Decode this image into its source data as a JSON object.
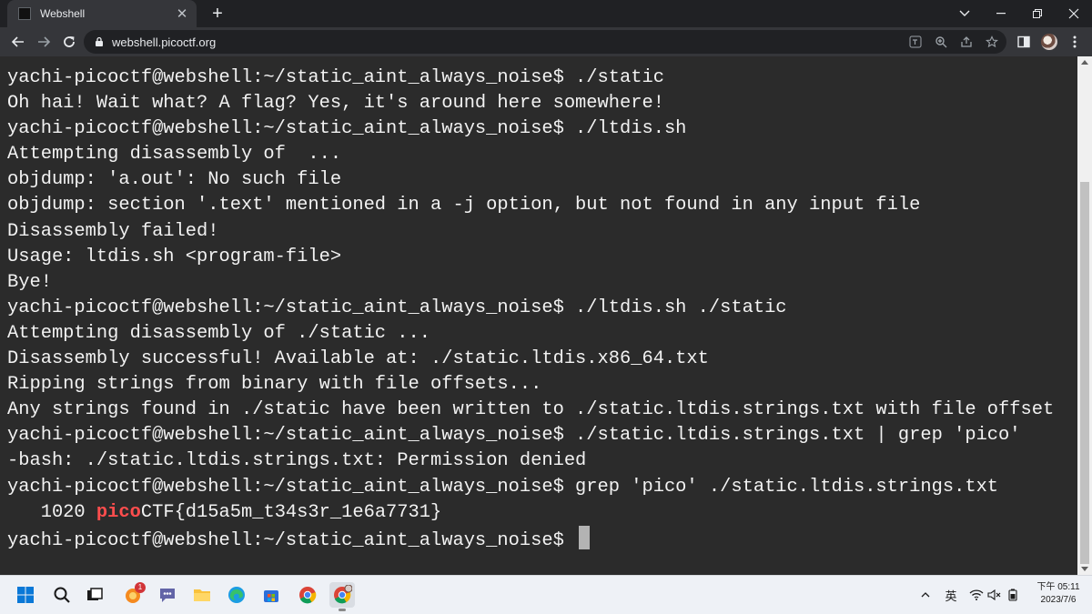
{
  "browser": {
    "tab_title": "Webshell",
    "url": "webshell.picoctf.org",
    "new_tab_symbol": "+",
    "close_tab_symbol": "✕"
  },
  "terminal": {
    "lines": [
      "yachi-picoctf@webshell:~/static_aint_always_noise$ ./static",
      "Oh hai! Wait what? A flag? Yes, it's around here somewhere!",
      "yachi-picoctf@webshell:~/static_aint_always_noise$ ./ltdis.sh",
      "Attempting disassembly of  ...",
      "objdump: 'a.out': No such file",
      "objdump: section '.text' mentioned in a -j option, but not found in any input file",
      "Disassembly failed!",
      "Usage: ltdis.sh <program-file>",
      "Bye!",
      "yachi-picoctf@webshell:~/static_aint_always_noise$ ./ltdis.sh ./static",
      "Attempting disassembly of ./static ...",
      "Disassembly successful! Available at: ./static.ltdis.x86_64.txt",
      "Ripping strings from binary with file offsets...",
      "Any strings found in ./static have been written to ./static.ltdis.strings.txt with file offset",
      "yachi-picoctf@webshell:~/static_aint_always_noise$ ./static.ltdis.strings.txt | grep 'pico'",
      "-bash: ./static.ltdis.strings.txt: Permission denied",
      "yachi-picoctf@webshell:~/static_aint_always_noise$ grep 'pico' ./static.ltdis.strings.txt"
    ],
    "flag_line": {
      "offset": "   1020 ",
      "match": "pico",
      "rest": "CTF{d15a5m_t34s3r_1e6a7731}"
    },
    "prompt": "yachi-picoctf@webshell:~/static_aint_always_noise$ "
  },
  "taskbar": {
    "notification_badge": "1",
    "input_method": "英",
    "clock_period": "下午",
    "time": "05:11",
    "date": "2023/7/6"
  },
  "colors": {
    "terminal_bg": "#2b2b2b",
    "terminal_fg": "#f2f2f2",
    "grep_match": "#ff4d4d",
    "chrome_dark": "#35363a"
  }
}
